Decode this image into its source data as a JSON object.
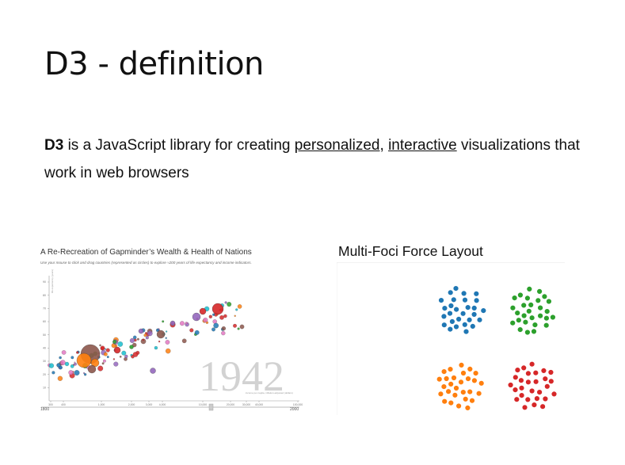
{
  "slide": {
    "title": "D3 - definition",
    "definition": {
      "term": "D3",
      "text_1": " is a JavaScript library for creating ",
      "link_1": "personalized",
      "sep": ", ",
      "link_2": "interactive",
      "text_2": " visualizations that work in web browsers"
    }
  },
  "figure_left": {
    "title": "A Re-Recreation of Gapminder’s Wealth & Health of Nations",
    "subtitle": "Use your mouse to click and drag countries (represented as circles) to explore ≈200 years of life expectancy and income indicators.",
    "year_label": "1942",
    "slider_start": "1800",
    "slider_end": "2000",
    "ylabel": "life expectancy (years)",
    "xlabel": "income per capita, inflation-adjusted (dollars)",
    "y_ticks": [
      "10",
      "20",
      "30",
      "40",
      "50",
      "60",
      "70",
      "80",
      "90"
    ],
    "x_ticks": [
      "300",
      "400",
      "1,000",
      "2,000",
      "3,000",
      "4,000",
      "10,000",
      "20,000",
      "30,000",
      "40,000",
      "100,000"
    ]
  },
  "figure_right": {
    "title": "Multi-Foci Force Layout",
    "clusters": [
      {
        "color": "#1f77b4"
      },
      {
        "color": "#2ca02c"
      },
      {
        "color": "#ff7f0e"
      },
      {
        "color": "#d62728"
      }
    ]
  }
}
